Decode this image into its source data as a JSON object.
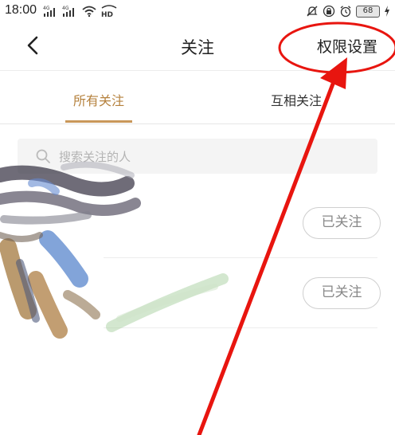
{
  "status_bar": {
    "time": "18:00",
    "battery": "68",
    "icons": [
      "signal-4g-icon",
      "signal-4g-icon",
      "wifi-icon",
      "hd-icon",
      "mute-icon",
      "lock-icon",
      "alarm-icon",
      "battery-icon",
      "charging-icon"
    ]
  },
  "header": {
    "back_icon": "chevron-left-icon",
    "title": "关注",
    "permission_label": "权限设置"
  },
  "tabs": [
    {
      "label": "所有关注",
      "active": true
    },
    {
      "label": "互相关注",
      "active": false
    }
  ],
  "search": {
    "placeholder": "搜索关注的人",
    "icon": "search-icon"
  },
  "list": {
    "items": [
      {
        "button_label": "已关注"
      },
      {
        "button_label": "已关注"
      }
    ]
  },
  "colors": {
    "accent": "#b5813d",
    "annotation": "#e8150f",
    "divider": "#ececec",
    "search_bg": "#f4f4f4"
  }
}
